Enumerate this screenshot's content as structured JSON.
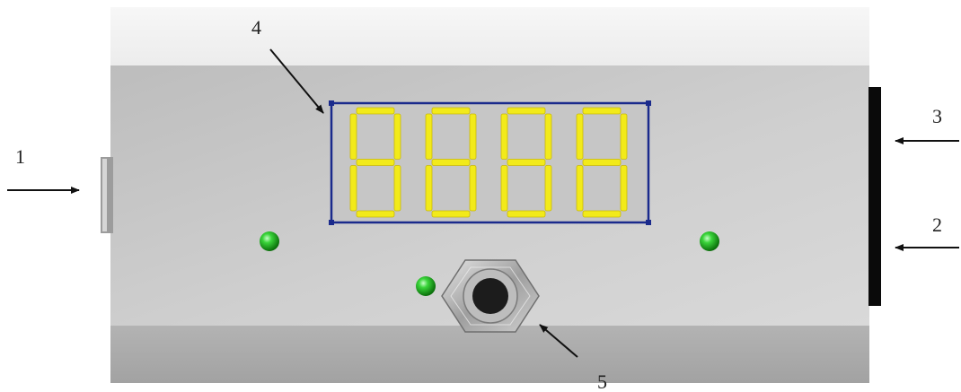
{
  "labels": {
    "one": "1",
    "two": "2",
    "three": "3",
    "four": "4",
    "five": "5"
  },
  "display": {
    "digit_count": 4,
    "segment_color": "#f2ea1a",
    "frame_color": "#1a2a8c"
  },
  "colors": {
    "housing_top": "#f1f1f1",
    "housing_body": "#c9c9c9",
    "housing_bottom": "#aaaaaa",
    "led": "#1fbf1f",
    "side_bar": "#0a0a0a"
  },
  "icons": {
    "connector": "hex-nut-connector-icon",
    "arrow": "arrow-icon"
  }
}
